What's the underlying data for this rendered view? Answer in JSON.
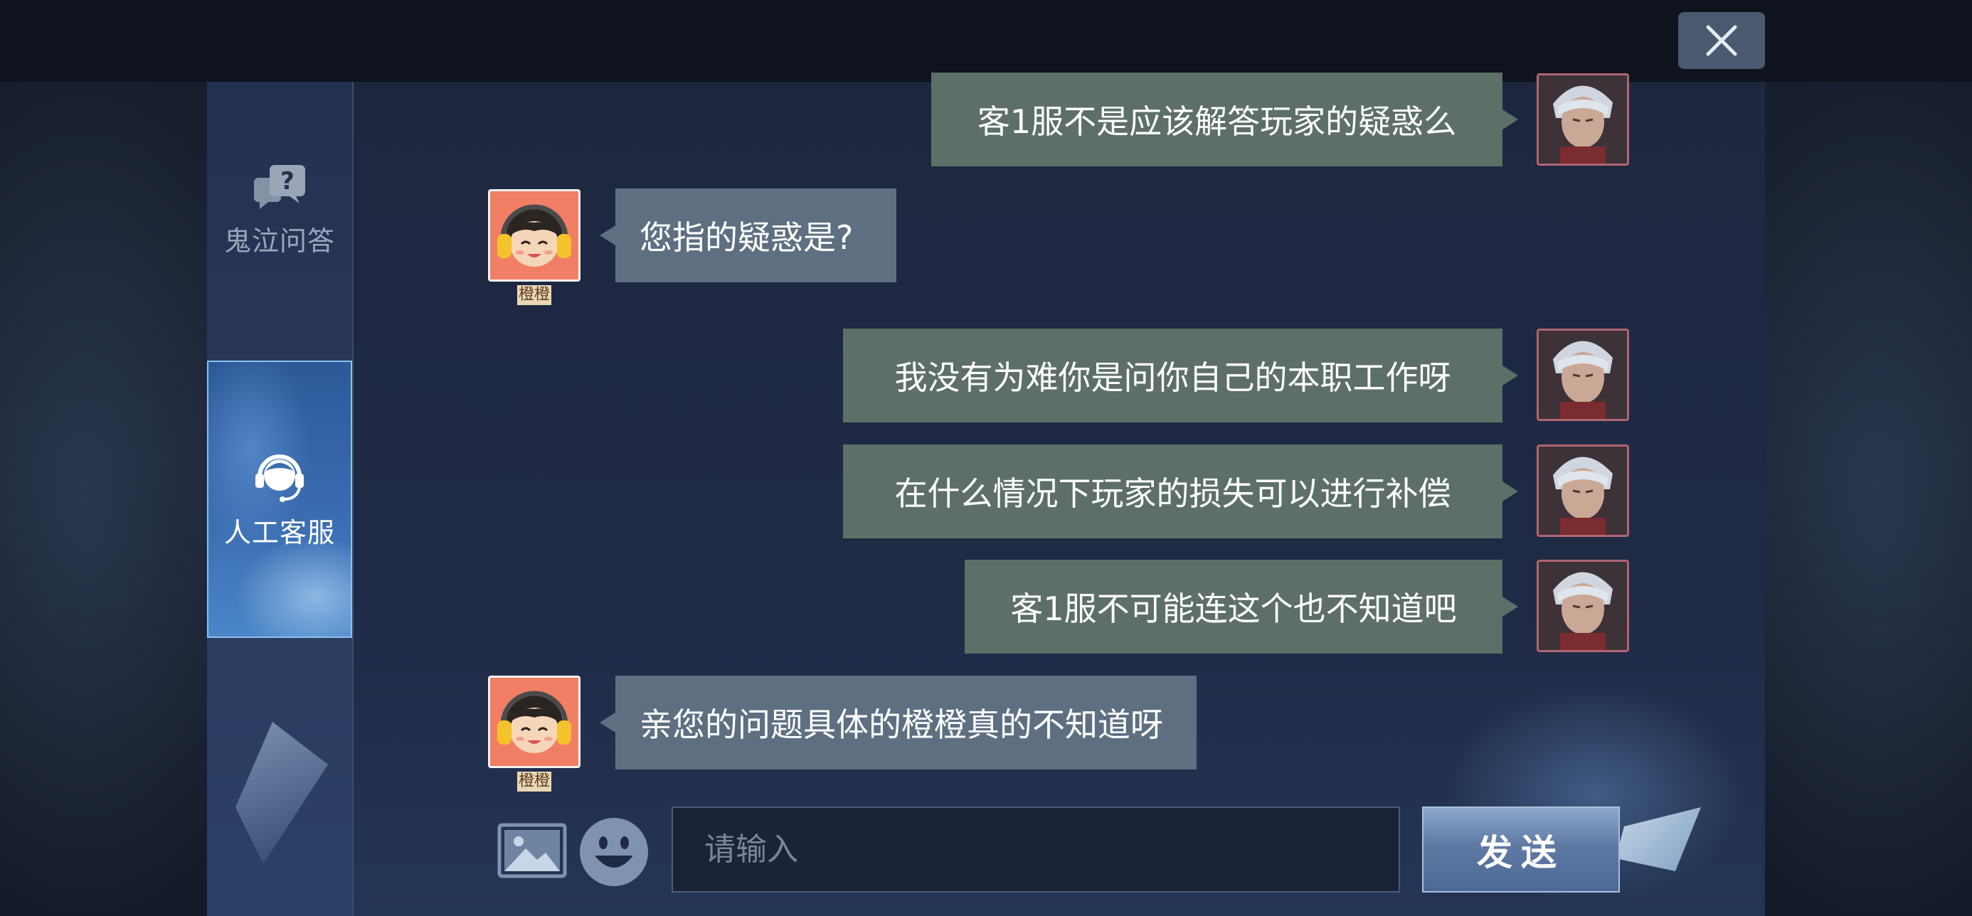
{
  "window": {
    "close_icon": "close-icon"
  },
  "sidebar": {
    "items": [
      {
        "label": "鬼泣问答",
        "icon": "question-chat-icon",
        "active": false
      },
      {
        "label": "人工客服",
        "icon": "headset-agent-icon",
        "active": true
      }
    ]
  },
  "chat": {
    "agent_name": "橙橙",
    "messages": [
      {
        "sender": "user",
        "text": "客1服不是应该解答玩家的疑惑么"
      },
      {
        "sender": "agent",
        "text": "您指的疑惑是?"
      },
      {
        "sender": "user",
        "text": "我没有为难你是问你自己的本职工作呀"
      },
      {
        "sender": "user",
        "text": "在什么情况下玩家的损失可以进行补偿"
      },
      {
        "sender": "user",
        "text": "客1服不可能连这个也不知道吧"
      },
      {
        "sender": "agent",
        "text": "亲您的问题具体的橙橙真的不知道呀"
      }
    ]
  },
  "composer": {
    "placeholder": "请输入",
    "value": "",
    "send_label": "发送",
    "image_icon": "image-icon",
    "emoji_icon": "emoji-icon"
  },
  "colors": {
    "user_bubble": "#5e6f67",
    "agent_bubble": "#5f6f82",
    "active_tab": "#3a6cb0",
    "send_button": "#5e7aa5"
  }
}
